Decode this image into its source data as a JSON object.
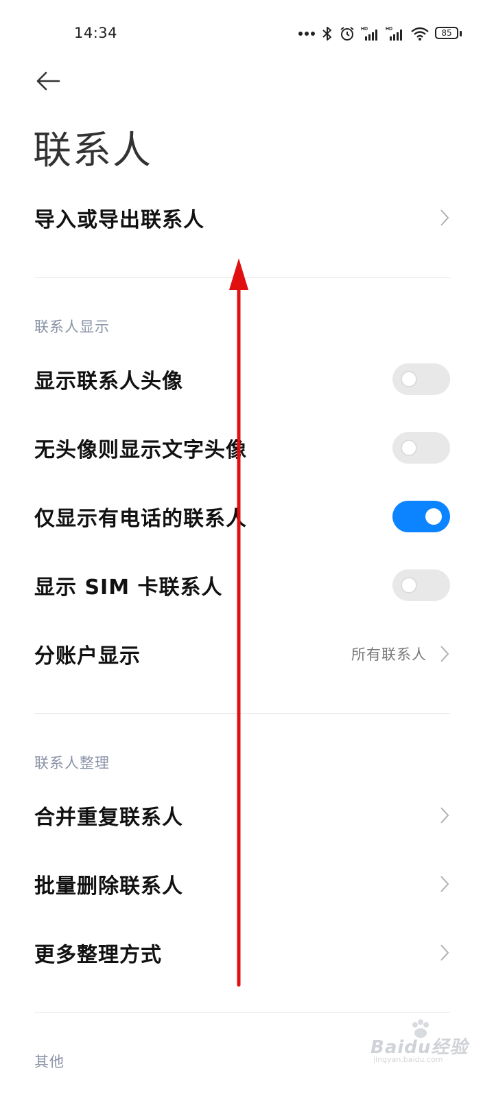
{
  "status_bar": {
    "time": "14:34",
    "battery": "85",
    "icons": [
      "more-dots-icon",
      "bluetooth-icon",
      "alarm-icon",
      "signal-hd-icon",
      "signal-hd-icon",
      "wifi-icon",
      "battery-icon"
    ]
  },
  "header": {
    "back_icon": "arrow-left-icon",
    "title": "联系人"
  },
  "import_export": {
    "label": "导入或导出联系人"
  },
  "display_section": {
    "header": "联系人显示",
    "items": [
      {
        "label": "显示联系人头像",
        "toggle": false
      },
      {
        "label": "无头像则显示文字头像",
        "toggle": false
      },
      {
        "label": "仅显示有电话的联系人",
        "toggle": true
      },
      {
        "label": "显示 SIM 卡联系人",
        "toggle": false
      }
    ],
    "account": {
      "label": "分账户显示",
      "value": "所有联系人"
    }
  },
  "organize_section": {
    "header": "联系人整理",
    "items": [
      {
        "label": "合并重复联系人"
      },
      {
        "label": "批量删除联系人"
      },
      {
        "label": "更多整理方式"
      }
    ]
  },
  "other_section": {
    "header": "其他"
  },
  "annotation": {
    "kind": "swipe-up-arrow",
    "color": "#e01010"
  },
  "watermark": {
    "text": "Baidu经验",
    "sub": "jingyan.baidu.com"
  },
  "colors": {
    "accent": "#0d84ff",
    "section_header": "#8a93a6",
    "toggle_off": "#e8e8e8"
  }
}
